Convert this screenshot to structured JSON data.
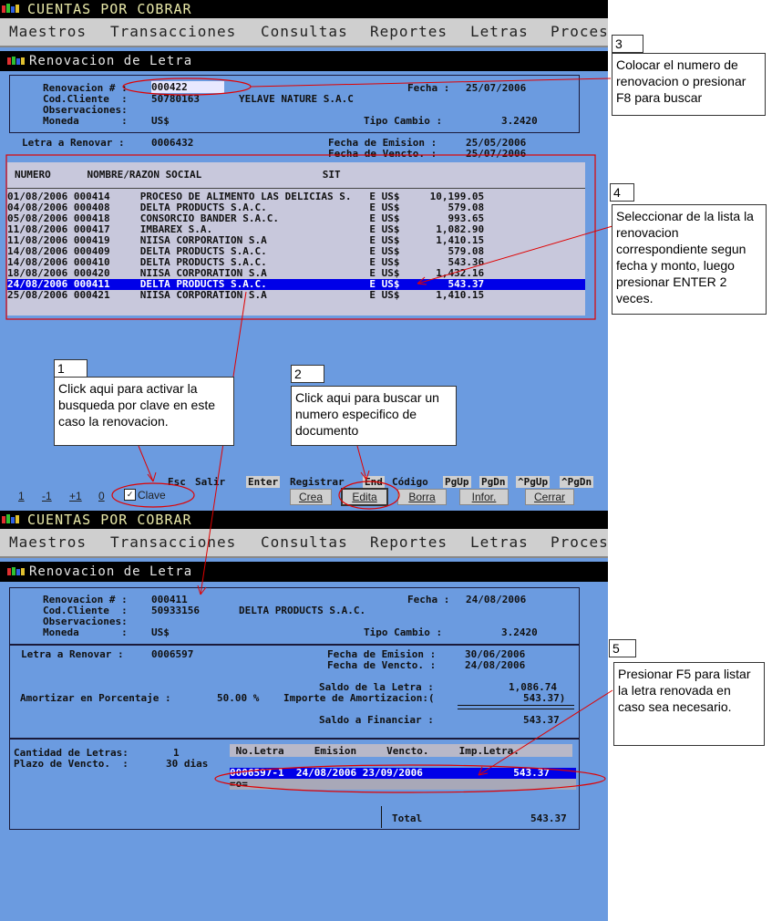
{
  "app_title": "CUENTAS POR COBRAR",
  "menu": [
    "Maestros",
    "Transacciones",
    "Consultas",
    "Reportes",
    "Letras",
    "Proces"
  ],
  "window_title": "Renovacion de Letra",
  "top": {
    "labels": {
      "renovacion": "Renovacion # :",
      "cod_cliente": "Cod.Cliente  :",
      "observaciones": "Observaciones:",
      "moneda": "Moneda       :",
      "fecha": "Fecha :",
      "tipo_cambio": "Tipo Cambio :",
      "letra_renovar": "Letra a Renovar :",
      "fecha_emision": "Fecha de Emision :",
      "fecha_vencto": "Fecha de Vencto. :"
    },
    "renovacion_value": "000422",
    "cod_cliente_value": "50780163",
    "cliente_name": "YELAVE NATURE S.A.C",
    "moneda_value": "US$",
    "fecha_value": "25/07/2006",
    "tipo_cambio_value": "3.2420",
    "letra_value": "0006432",
    "emision_value": "25/05/2006",
    "vencto_value": "25/07/2006",
    "list_header": "NUMERO      NOMBRE/RAZON SOCIAL                    SIT",
    "rows": [
      "01/08/2006 000414     PROCESO DE ALIMENTO LAS DELICIAS S.   E US$     10,199.05",
      "04/08/2006 000408     DELTA PRODUCTS S.A.C.                 E US$        579.08",
      "05/08/2006 000418     CONSORCIO BANDER S.A.C.               E US$        993.65",
      "11/08/2006 000417     IMBAREX S.A.                          E US$      1,082.90",
      "11/08/2006 000419     NIISA CORPORATION S.A                 E US$      1,410.15",
      "14/08/2006 000409     DELTA PRODUCTS S.A.C.                 E US$        579.08",
      "14/08/2006 000410     DELTA PRODUCTS S.A.C.                 E US$        543.36",
      "18/08/2006 000420     NIISA CORPORATION S.A                 E US$      1,432.16",
      "24/08/2006 000411     DELTA PRODUCTS S.A.C.                 E US$        543.37",
      "25/08/2006 000421     NIISA CORPORATION S.A                 E US$      1,410.15"
    ],
    "selected_row": 8,
    "keyhints": [
      {
        "key": "Esc",
        "label": "Salir"
      },
      {
        "key": "Enter",
        "label": "Registrar"
      },
      {
        "key": "End",
        "label": "Código"
      },
      {
        "key": "PgUp",
        "label": ""
      },
      {
        "key": "PgDn",
        "label": ""
      },
      {
        "key": "^PgUp",
        "label": ""
      },
      {
        "key": "^PgDn",
        "label": ""
      }
    ],
    "nav": [
      "1",
      "-1",
      "+1",
      "0"
    ],
    "clave_label": "Clave",
    "buttons": [
      "Crea",
      "Edita",
      "Borra",
      "Infor.",
      "Cerrar"
    ]
  },
  "bottom": {
    "renovacion_value": "000411",
    "cod_cliente_value": "50933156",
    "cliente_name": "DELTA PRODUCTS S.A.C.",
    "moneda_value": "US$",
    "fecha_value": "24/08/2006",
    "tipo_cambio_value": "3.2420",
    "letra_value": "0006597",
    "emision_value": "30/06/2006",
    "vencto_value": "24/08/2006",
    "saldo_letra_label": "Saldo de la Letra :",
    "saldo_letra_value": "1,086.74",
    "amortizar_label": "Amortizar en Porcentaje :",
    "amortizar_value": "50.00 %",
    "importe_label": "Importe de Amortizacion:(",
    "importe_value": "543.37)",
    "saldo_financiar_label": "Saldo a Financiar :",
    "saldo_financiar_value": "543.37",
    "cantidad_label": "Cantidad de Letras:",
    "cantidad_value": "1",
    "plazo_label": "Plazo de Vencto.  :",
    "plazo_value": "30 dias",
    "grid_header": " No.Letra     Emision     Vencto.     Imp.Letra.",
    "grid_row": "0006597-1  24/08/2006 23/09/2006               543.37",
    "grid_blank": "=o=",
    "total_label": "Total",
    "total_value": "543.37"
  },
  "callouts": [
    {
      "num": "1",
      "text": "Click aqui para activar la busqueda por clave en este caso la renovacion."
    },
    {
      "num": "2",
      "text": "Click aqui para buscar un numero especifico de documento"
    },
    {
      "num": "3",
      "text": "Colocar el numero de renovacion o presionar F8 para buscar"
    },
    {
      "num": "4",
      "text": "Seleccionar de la lista la renovacion correspondiente segun fecha y monto, luego presionar ENTER 2 veces."
    },
    {
      "num": "5",
      "text": "Presionar F5 para listar la letra renovada en caso sea necesario."
    }
  ],
  "colors": {
    "screen_bg": "#6b9be0",
    "selection": "#0000e8",
    "annotation": "#e00000"
  }
}
